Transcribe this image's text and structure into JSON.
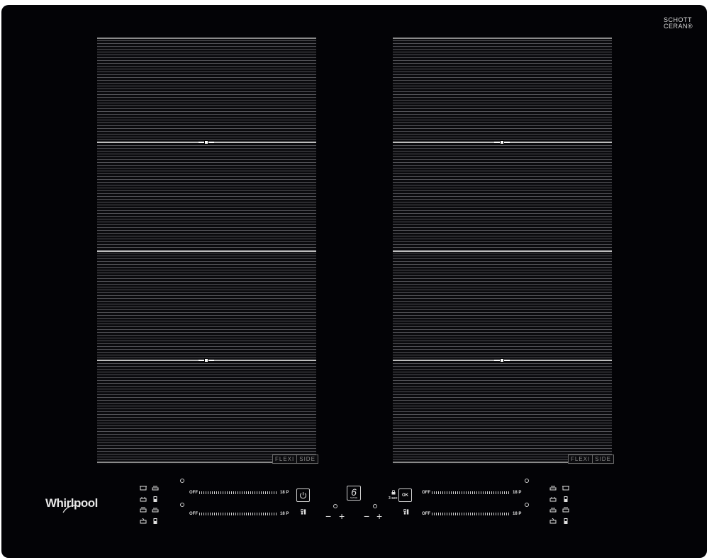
{
  "brand": {
    "schott_line1": "SCHOTT",
    "schott_line2": "CERAN®",
    "whirlpool_logo": "Whirlpool"
  },
  "zones": {
    "left_badge": [
      "FLEXI",
      "SIDE"
    ],
    "right_badge": [
      "FLEXI",
      "SIDE"
    ]
  },
  "controls": {
    "left_top_slider": {
      "off_label": "OFF",
      "max_label": "18 P"
    },
    "left_bottom_slider": {
      "off_label": "OFF",
      "max_label": "18 P"
    },
    "right_top_slider": {
      "off_label": "OFF",
      "max_label": "18 P"
    },
    "right_bottom_slider": {
      "off_label": "OFF",
      "max_label": "18 P"
    },
    "sixth_sense_label": "6",
    "sixth_sense_sub": "SENSE",
    "ok_label": "OK",
    "lock_hint": "3 sec",
    "minus_symbol": "−",
    "plus_symbol": "+"
  },
  "icons": {
    "power": "power-icon",
    "timer": "timer-icon",
    "pot": "pot-icon",
    "pan": "pan-icon",
    "bridge": "bridge-icon",
    "lock": "lock-icon"
  },
  "colors": {
    "glass": "#030306",
    "print": "#e0e0e0",
    "zone_line": "#505055"
  }
}
